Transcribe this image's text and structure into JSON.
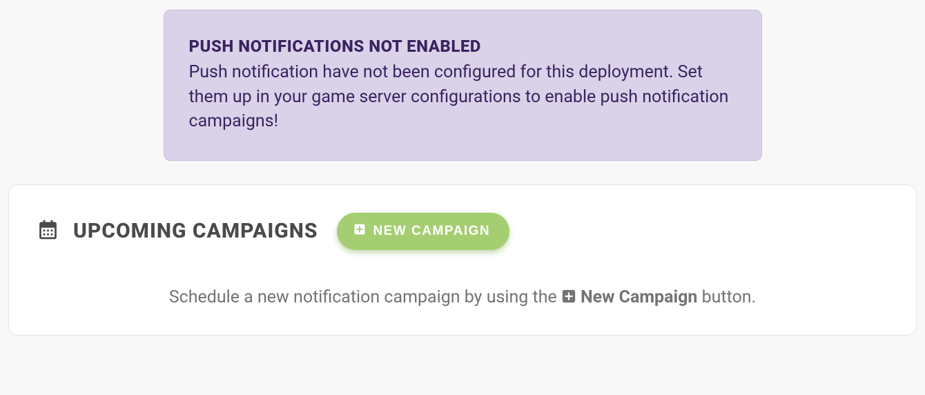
{
  "alert": {
    "title": "PUSH NOTIFICATIONS NOT ENABLED",
    "body": "Push notification have not been configured for this deployment. Set them up in your game server configurations to enable push notification campaigns!"
  },
  "campaigns": {
    "title": "UPCOMING CAMPAIGNS",
    "new_button_label": "NEW CAMPAIGN",
    "helper_prefix": "Schedule a new notification campaign by using the ",
    "helper_button_ref": "New Campaign",
    "helper_suffix": " button."
  }
}
